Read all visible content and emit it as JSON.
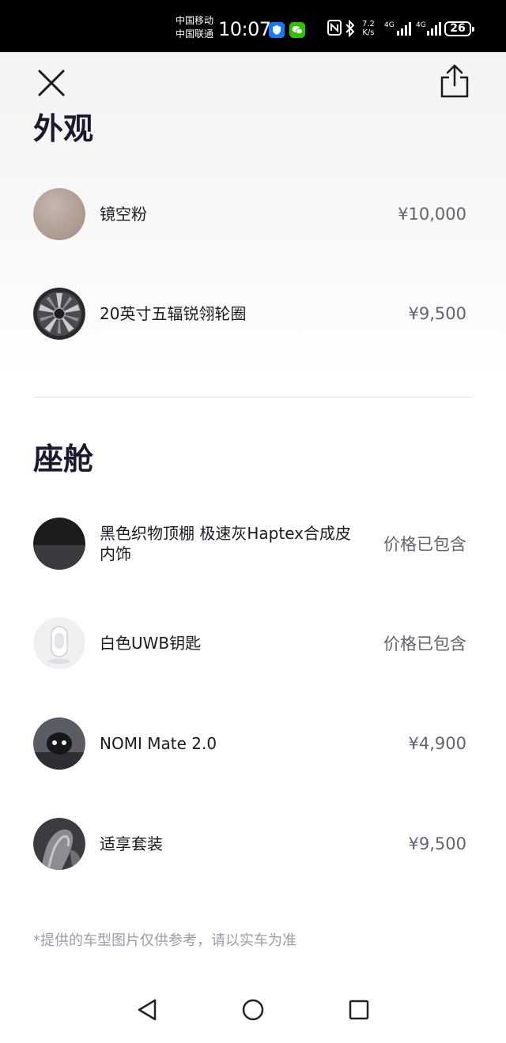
{
  "status_bar": {
    "carrier_1": "中国移动",
    "carrier_2": "中国联通",
    "time": "10:07",
    "net_speed_value": "7.2",
    "net_speed_unit": "K/s",
    "net_type_1": "4G",
    "net_type_2": "4G",
    "battery": "26",
    "icons": [
      "shield-app-icon",
      "wechat-icon",
      "nfc-icon",
      "bluetooth-icon",
      "signal-icon",
      "signal-icon",
      "battery-icon"
    ]
  },
  "header": {
    "close_icon": "close-icon",
    "share_icon": "share-icon"
  },
  "sections": {
    "exterior": {
      "title": "外观",
      "items": [
        {
          "name": "镜空粉",
          "price": "¥10,000",
          "thumb": "paint-swatch",
          "color": "#b9a79f"
        },
        {
          "name": "20英寸五辐锐翎轮圈",
          "price": "¥9,500",
          "thumb": "wheel"
        }
      ]
    },
    "cabin": {
      "title": "座舱",
      "items": [
        {
          "name": "黑色织物顶棚 极速灰Haptex合成皮内饰",
          "price": "价格已包含",
          "thumb": "interior-swatch"
        },
        {
          "name": "白色UWB钥匙",
          "price": "价格已包含",
          "thumb": "key-fob"
        },
        {
          "name": "NOMI Mate 2.0",
          "price": "¥4,900",
          "thumb": "nomi-robot"
        },
        {
          "name": "适享套装",
          "price": "¥9,500",
          "thumb": "seat"
        }
      ]
    }
  },
  "disclaimer": "*提供的车型图片仅供参考，请以实车为准",
  "nav_bar": {
    "buttons": [
      "back-icon",
      "home-icon",
      "recents-icon"
    ]
  }
}
